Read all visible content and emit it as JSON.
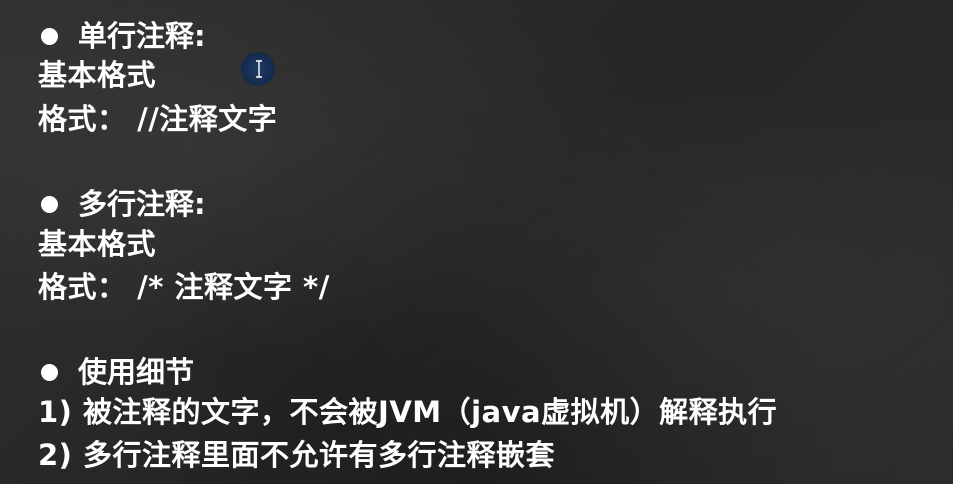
{
  "sections": [
    {
      "heading": "单行注释:",
      "lines": [
        "基本格式",
        "格式： //注释文字"
      ]
    },
    {
      "heading": "多行注释:",
      "lines": [
        "基本格式",
        "格式： /*  注释文字 */"
      ]
    },
    {
      "heading": "使用细节",
      "lines": [
        "1) 被注释的文字，不会被JVM（java虚拟机）解释执行",
        "2) 多行注释里面不允许有多行注释嵌套"
      ]
    }
  ],
  "icons": {
    "bullet": "bullet-dot-icon",
    "cursor": "text-cursor-icon"
  },
  "colors": {
    "background": "#2a2a2a",
    "text": "#ffffff",
    "cursor_highlight": "#1f3b66"
  }
}
